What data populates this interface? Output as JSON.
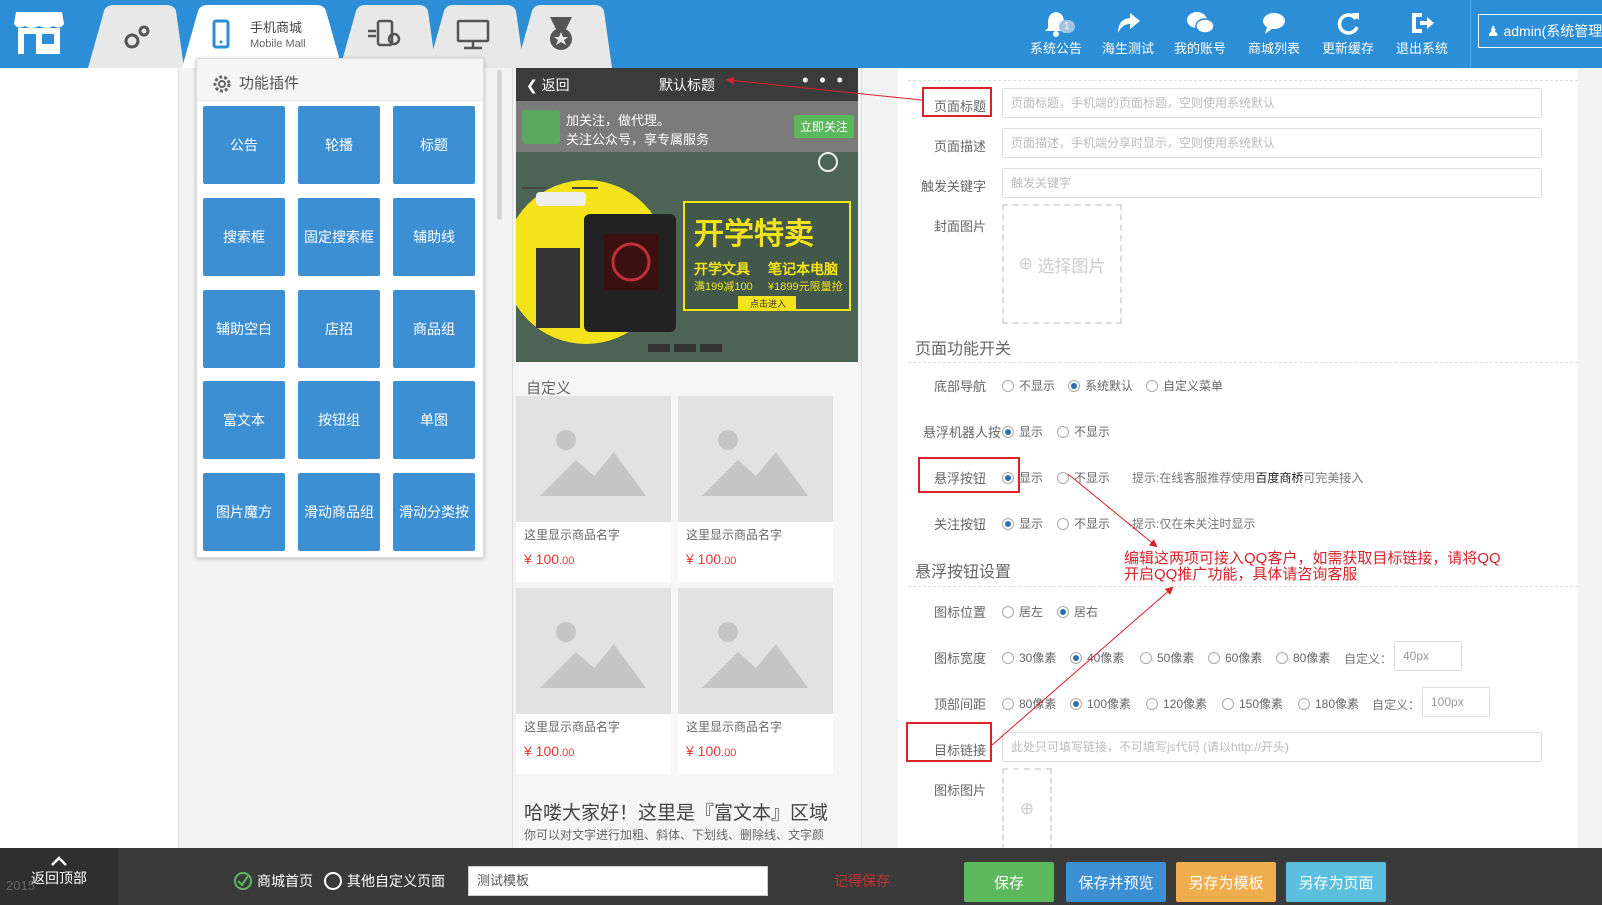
{
  "topbar": {
    "tabs": [
      {
        "icon": "gears-icon"
      },
      {
        "icon": "mobile-icon",
        "title": "手机商城",
        "subtitle": "Mobile Mall"
      },
      {
        "icon": "mobile-settings-icon"
      },
      {
        "icon": "monitor-icon"
      },
      {
        "icon": "medal-icon"
      }
    ],
    "actions": [
      {
        "label": "系统公告",
        "icon": "bell-icon",
        "badge": "1"
      },
      {
        "label": "海生测试",
        "icon": "share-icon"
      },
      {
        "label": "我的账号",
        "icon": "wechat-icon"
      },
      {
        "label": "商城列表",
        "icon": "chat-icon"
      },
      {
        "label": "更新缓存",
        "icon": "refresh-icon"
      },
      {
        "label": "退出系统",
        "icon": "logout-icon"
      }
    ],
    "user": "admin(系统管理"
  },
  "plugins": {
    "title": "功能插件",
    "buttons": [
      "公告",
      "轮播",
      "标题",
      "搜索框",
      "固定搜索框",
      "辅助线",
      "辅助空白",
      "店招",
      "商品组",
      "富文本",
      "按钮组",
      "单图",
      "图片魔方",
      "滑动商品组",
      "滑动分类按"
    ]
  },
  "phone": {
    "back": "返回",
    "title": "默认标题",
    "dots": "• • •",
    "follow": {
      "line1": "加关注，做代理。",
      "line2": "关注公众号，享专属服务",
      "button": "立即关注"
    },
    "banner": {
      "headline": "开学特卖",
      "left_title": "开学文具",
      "left_sub": "满199减100",
      "right_title": "笔记本电脑",
      "right_sub": "¥1899元限量抢",
      "cta": "点击进入"
    },
    "custom_title": "自定义",
    "goods": [
      {
        "name": "这里显示商品名字",
        "price": "¥ 100",
        "cents": ".00"
      },
      {
        "name": "这里显示商品名字",
        "price": "¥ 100",
        "cents": ".00"
      },
      {
        "name": "这里显示商品名字",
        "price": "¥ 100",
        "cents": ".00"
      },
      {
        "name": "这里显示商品名字",
        "price": "¥ 100",
        "cents": ".00"
      }
    ],
    "rich_head": "哈喽大家好！这里是『富文本』区域",
    "rich_body": "你可以对文字进行加粗、斜体、下划线、删除线、文字颜"
  },
  "settings": {
    "page_title_label": "页面标题",
    "page_title_placeholder": "页面标题，手机端的页面标题，空则使用系统默认",
    "page_desc_label": "页面描述",
    "page_desc_placeholder": "页面描述，手机端分享时显示，空则使用系统默认",
    "keyword_label": "触发关键字",
    "keyword_placeholder": "触发关键字",
    "cover_label": "封面图片",
    "cover_button": "选择图片",
    "switch_section": "页面功能开关",
    "bottom_nav_label": "底部导航",
    "bottom_nav_options": [
      "不显示",
      "系统默认",
      "自定义菜单"
    ],
    "robot_label": "悬浮机器人按",
    "float_btn_label": "悬浮按钮",
    "follow_btn_label": "关注按钮",
    "show": "显示",
    "hide": "不显示",
    "float_tip_pre": "提示:在线客服推荐使用",
    "float_tip_bold": "百度商桥",
    "float_tip_post": "可完美接入",
    "follow_tip": "提示:仅在未关注时显示",
    "float_section": "悬浮按钮设置",
    "icon_pos_label": "图标位置",
    "icon_pos_options": [
      "居左",
      "居右"
    ],
    "icon_width_label": "图标宽度",
    "icon_width_options": [
      "30像素",
      "40像素",
      "50像素",
      "60像素",
      "80像素"
    ],
    "custom_label": "自定义：",
    "icon_width_custom": "40px",
    "top_gap_label": "顶部间距",
    "top_gap_options": [
      "80像素",
      "100像素",
      "120像素",
      "150像素",
      "180像素"
    ],
    "top_gap_custom": "100px",
    "link_label": "目标链接",
    "link_placeholder": "此处只可填写链接，不可填写js代码 (请以http://开头)",
    "icon_img_label": "图标图片",
    "annotation": "编辑这两项可接入QQ客户，如需获取目标链接，请将QQ开启QQ推广功能，具体请咨询客服",
    "annotation_line1": "编辑这两项可接入QQ客户，如需获取目标链接，请将QQ",
    "annotation_line2": "开启QQ推广功能，具体请咨询客服"
  },
  "bottombar": {
    "back_top": "返回顶部",
    "copyright": "2015",
    "home_option": "商城首页",
    "other_option": "其他自定义页面",
    "template_name": "测试模板",
    "remember": "记得保存",
    "save": "保存",
    "save_preview": "保存并预览",
    "save_template": "另存为模板",
    "save_page": "另存为页面"
  },
  "colors": {
    "topbar": "#2c8ed6",
    "plugin_button": "#3d8fd4",
    "annotation": "#d9222a",
    "save": "#5cb85c",
    "save_template": "#f0ad4e",
    "save_page": "#5bc0de"
  }
}
